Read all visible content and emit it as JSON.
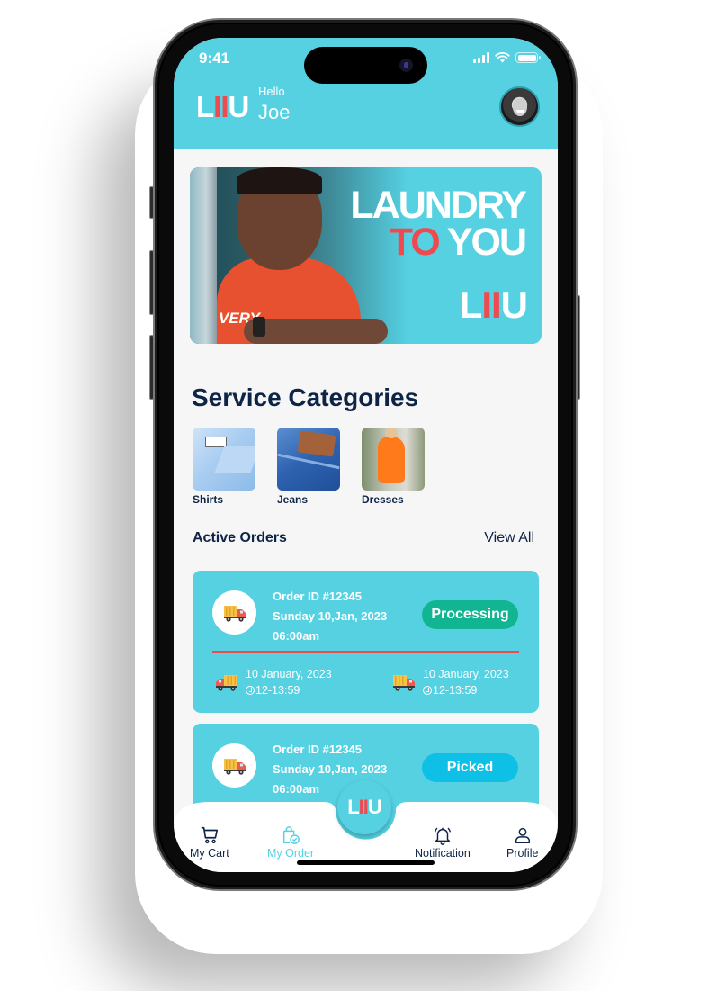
{
  "status_bar": {
    "time": "9:41"
  },
  "header": {
    "logo": {
      "part1": "L",
      "part2": "II",
      "part3": "U"
    },
    "greeting": "Hello",
    "username": "Joe",
    "avatar_icon": "user-avatar"
  },
  "banner": {
    "line1": "LAUNDRY",
    "line2_accent": "TO",
    "line2_rest": " YOU",
    "shirt_text": "VERY",
    "logo": {
      "part1": "L",
      "part2": "II",
      "part3": "U"
    }
  },
  "categories": {
    "title": "Service Categories",
    "items": [
      {
        "label": "Shirts",
        "image": "shirts-thumbnail"
      },
      {
        "label": "Jeans",
        "image": "jeans-thumbnail"
      },
      {
        "label": "Dresses",
        "image": "dresses-thumbnail"
      }
    ]
  },
  "orders": {
    "title": "Active Orders",
    "view_all": "View All",
    "items": [
      {
        "order_id": "Order ID #12345",
        "date": "Sunday 10,Jan, 2023",
        "time": "06:00am",
        "status": "Processing",
        "status_color": "#11b592",
        "pickup": {
          "date": "10 January, 2023",
          "time": "12-13:59"
        },
        "delivery": {
          "date": "10 January, 2023",
          "time": "12-13:59"
        }
      },
      {
        "order_id": "Order ID #12345",
        "date": "Sunday 10,Jan, 2023",
        "time": "06:00am",
        "status": "Picked",
        "status_color": "#0fc0e6"
      }
    ]
  },
  "bottom_nav": {
    "items": [
      {
        "label": "My Cart",
        "icon": "cart-icon",
        "active": false
      },
      {
        "label": "My Order",
        "icon": "shopping-bag-check-icon",
        "active": true
      },
      {
        "label": "Notification",
        "icon": "bell-icon",
        "active": false
      },
      {
        "label": "Profile",
        "icon": "user-icon",
        "active": false
      }
    ],
    "center_logo": {
      "part1": "L",
      "part2": "II",
      "part3": "U"
    }
  },
  "colors": {
    "brand": "#55d1e2",
    "accent_red": "#f04a4f",
    "navy": "#0e2447",
    "processing": "#11b592",
    "picked": "#0fc0e6"
  }
}
